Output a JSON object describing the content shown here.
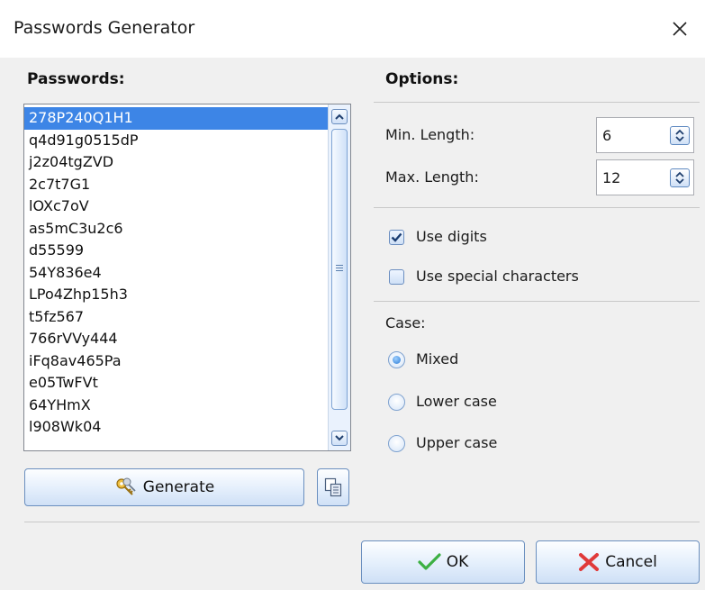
{
  "window": {
    "title": "Passwords Generator"
  },
  "passwords": {
    "heading": "Passwords:",
    "items": [
      "278P240Q1H1",
      "q4d91g0515dP",
      "j2z04tgZVD",
      "2c7t7G1",
      "lOXc7oV",
      "as5mC3u2c6",
      "d55599",
      "54Y836e4",
      "LPo4Zhp15h3",
      "t5fz567",
      "766rVVy444",
      "iFq8av465Pa",
      "e05TwFVt",
      "64YHmX",
      "l908Wk04"
    ],
    "selected_index": 0,
    "generate_label": "Generate"
  },
  "options": {
    "heading": "Options:",
    "min_length_label": "Min. Length:",
    "min_length_value": "6",
    "max_length_label": "Max. Length:",
    "max_length_value": "12",
    "use_digits_label": "Use digits",
    "use_digits_checked": true,
    "use_special_label": "Use special characters",
    "use_special_checked": false,
    "case_label": "Case:",
    "case_options": [
      "Mixed",
      "Lower case",
      "Upper case"
    ],
    "case_selected": "Mixed"
  },
  "footer": {
    "ok_label": "OK",
    "cancel_label": "Cancel"
  },
  "colors": {
    "selection": "#3d85e6",
    "ok_check": "#3cb043",
    "cancel_x": "#e03a3a"
  }
}
